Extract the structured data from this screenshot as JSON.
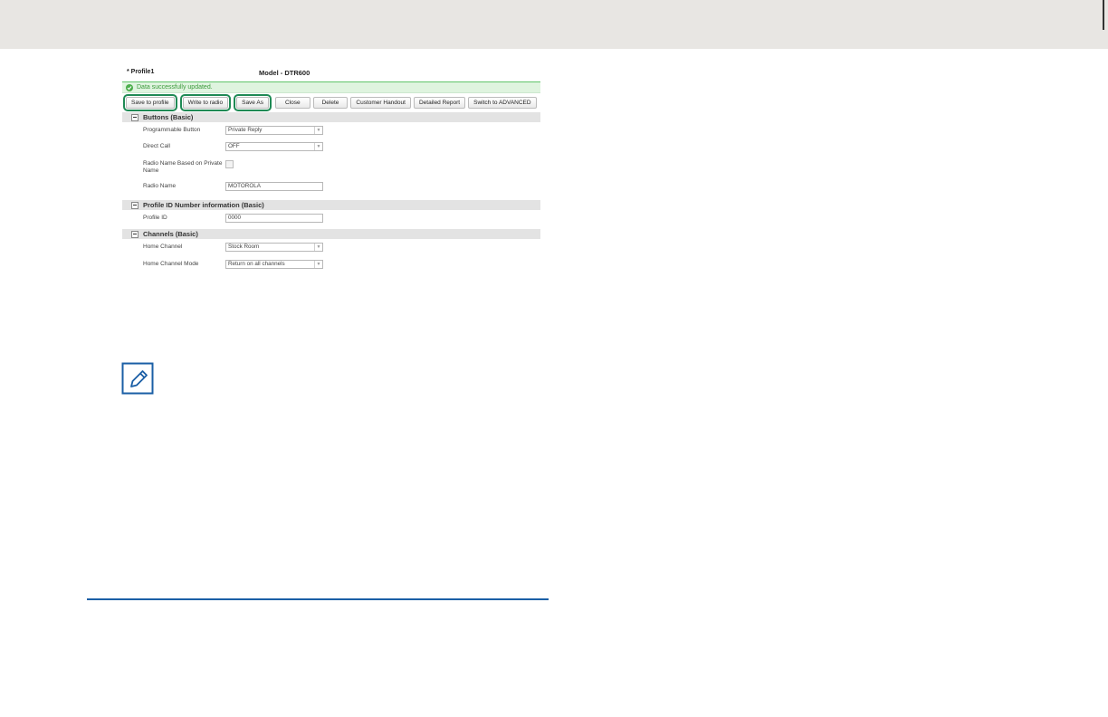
{
  "header": {
    "profile_name": "* Profile1",
    "model_title": "Model - DTR600"
  },
  "status": {
    "message": "Data successfully updated.",
    "color": "#4cae4c"
  },
  "toolbar": {
    "save_to_profile": "Save to profile",
    "write_to_radio": "Write to radio",
    "save_as": "Save As",
    "close": "Close",
    "delete": "Delete",
    "customer_handout": "Customer Handout",
    "detailed_report": "Detailed Report",
    "switch_advanced": "Switch to ADVANCED",
    "highlight_color": "#1f8a55"
  },
  "sections": {
    "buttons": {
      "title": "Buttons (Basic)",
      "programmable_button": {
        "label": "Programmable Button",
        "value": "Private Reply"
      },
      "direct_call": {
        "label": "Direct Call",
        "value": "OFF"
      },
      "radio_name_based": {
        "label": "Radio Name Based on Private Name",
        "checked": false
      },
      "radio_name": {
        "label": "Radio Name",
        "value": "MOTOROLA"
      }
    },
    "profile_id": {
      "title": "Profile ID Number information (Basic)",
      "profile_id": {
        "label": "Profile ID",
        "value": "0000"
      }
    },
    "channels": {
      "title": "Channels (Basic)",
      "home_channel": {
        "label": "Home Channel",
        "value": "Stock Room"
      },
      "home_channel_mode": {
        "label": "Home Channel Mode",
        "value": "Return on all channels"
      }
    }
  },
  "icons": {
    "note": "note-pencil-icon",
    "check": "check-circle-icon",
    "collapse": "collapse-minus-icon",
    "dropdown": "chevron-down-icon"
  },
  "accent_rule_color": "#1b5fa6"
}
